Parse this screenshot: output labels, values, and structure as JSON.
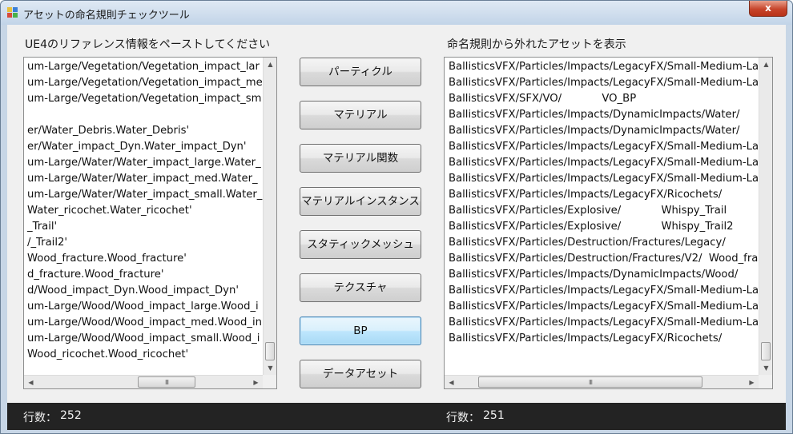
{
  "window": {
    "title": "アセットの命名規則チェックツール",
    "close_glyph": "x"
  },
  "left_panel": {
    "label": "UE4のリファレンス情報をペーストしてください",
    "lines": [
      "um-Large/Vegetation/Vegetation_impact_lar",
      "um-Large/Vegetation/Vegetation_impact_me",
      "um-Large/Vegetation/Vegetation_impact_sm",
      "",
      "er/Water_Debris.Water_Debris'",
      "er/Water_impact_Dyn.Water_impact_Dyn'",
      "um-Large/Water/Water_impact_large.Water_",
      "um-Large/Water/Water_impact_med.Water_",
      "um-Large/Water/Water_impact_small.Water_",
      "Water_ricochet.Water_ricochet'",
      "_Trail'",
      "/_Trail2'",
      "Wood_fracture.Wood_fracture'",
      "d_fracture.Wood_fracture'",
      "d/Wood_impact_Dyn.Wood_impact_Dyn'",
      "um-Large/Wood/Wood_impact_large.Wood_i",
      "um-Large/Wood/Wood_impact_med.Wood_in",
      "um-Large/Wood/Wood_impact_small.Wood_i",
      "Wood_ricochet.Wood_ricochet'"
    ],
    "status_label": "行数：",
    "line_count": "252"
  },
  "buttons": [
    "パーティクル",
    "マテリアル",
    "マテリアル関数",
    "マテリアルインスタンス",
    "スタティックメッシュ",
    "テクスチャ",
    "BP",
    "データアセット"
  ],
  "right_panel": {
    "label": "命名規則から外れたアセットを表示",
    "lines": [
      "BallisticsVFX/Particles/Impacts/LegacyFX/Small-Medium-La",
      "BallisticsVFX/Particles/Impacts/LegacyFX/Small-Medium-La",
      "BallisticsVFX/SFX/VO/            VO_BP",
      "BallisticsVFX/Particles/Impacts/DynamicImpacts/Water/",
      "BallisticsVFX/Particles/Impacts/DynamicImpacts/Water/",
      "BallisticsVFX/Particles/Impacts/LegacyFX/Small-Medium-La",
      "BallisticsVFX/Particles/Impacts/LegacyFX/Small-Medium-La",
      "BallisticsVFX/Particles/Impacts/LegacyFX/Small-Medium-La",
      "BallisticsVFX/Particles/Impacts/LegacyFX/Ricochets/",
      "BallisticsVFX/Particles/Explosive/            Whispy_Trail",
      "BallisticsVFX/Particles/Explosive/            Whispy_Trail2",
      "BallisticsVFX/Particles/Destruction/Fractures/Legacy/",
      "BallisticsVFX/Particles/Destruction/Fractures/V2/  Wood_fra",
      "BallisticsVFX/Particles/Impacts/DynamicImpacts/Wood/",
      "BallisticsVFX/Particles/Impacts/LegacyFX/Small-Medium-La",
      "BallisticsVFX/Particles/Impacts/LegacyFX/Small-Medium-La",
      "BallisticsVFX/Particles/Impacts/LegacyFX/Small-Medium-La",
      "BallisticsVFX/Particles/Impacts/LegacyFX/Ricochets/"
    ],
    "status_label": "行数：",
    "line_count": "251"
  },
  "scroll_glyphs": {
    "up": "▲",
    "down": "▼",
    "left": "◀",
    "right": "▶",
    "grip": "III"
  },
  "colors": {
    "title_gradient_top": "#dfe9f4",
    "close_button": "#c7452b",
    "status_bar": "#232323",
    "focused_button": "#bee6fd"
  }
}
